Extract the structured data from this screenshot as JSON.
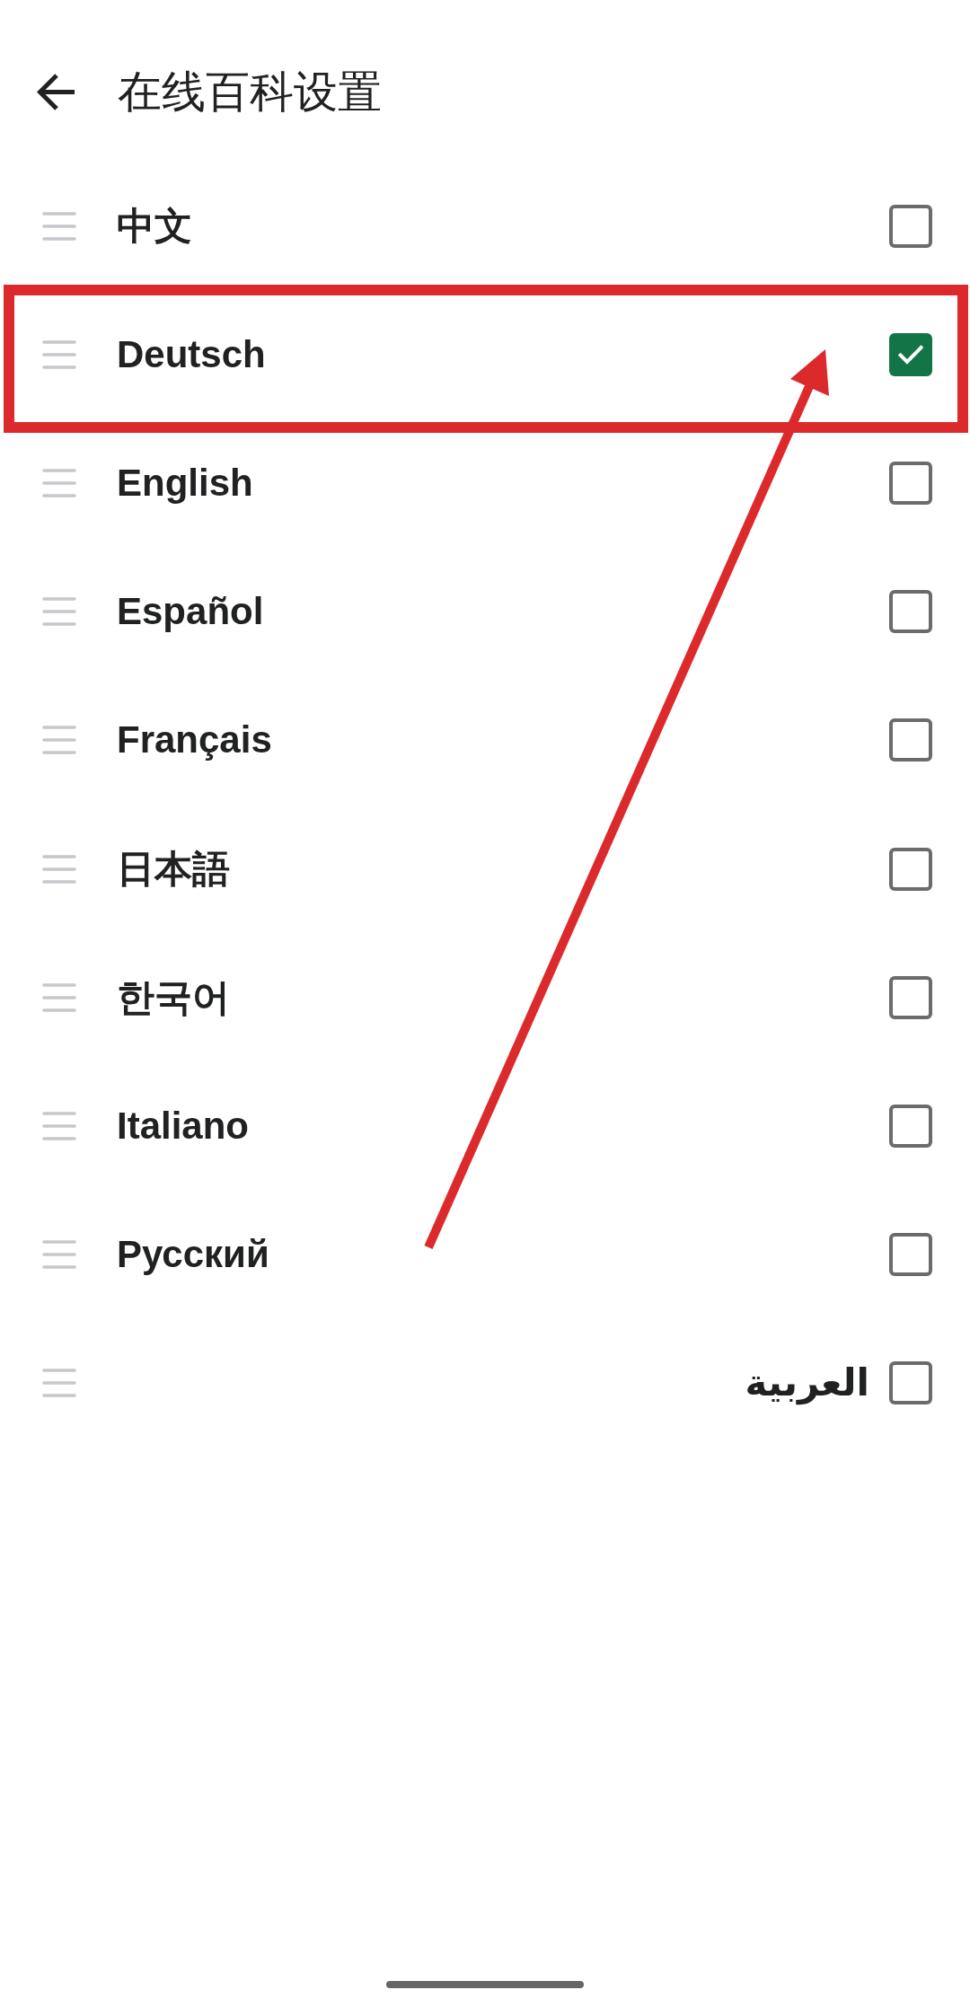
{
  "header": {
    "title": "在线百科设置"
  },
  "languages": [
    {
      "label": "中文",
      "checked": false,
      "highlighted": false
    },
    {
      "label": "Deutsch",
      "checked": true,
      "highlighted": true
    },
    {
      "label": "English",
      "checked": false,
      "highlighted": false
    },
    {
      "label": "Español",
      "checked": false,
      "highlighted": false
    },
    {
      "label": "Français",
      "checked": false,
      "highlighted": false
    },
    {
      "label": "日本語",
      "checked": false,
      "highlighted": false
    },
    {
      "label": "한국어",
      "checked": false,
      "highlighted": false
    },
    {
      "label": "Italiano",
      "checked": false,
      "highlighted": false
    },
    {
      "label": "Русский",
      "checked": false,
      "highlighted": false
    },
    {
      "label": "العربية",
      "checked": false,
      "highlighted": false
    }
  ]
}
